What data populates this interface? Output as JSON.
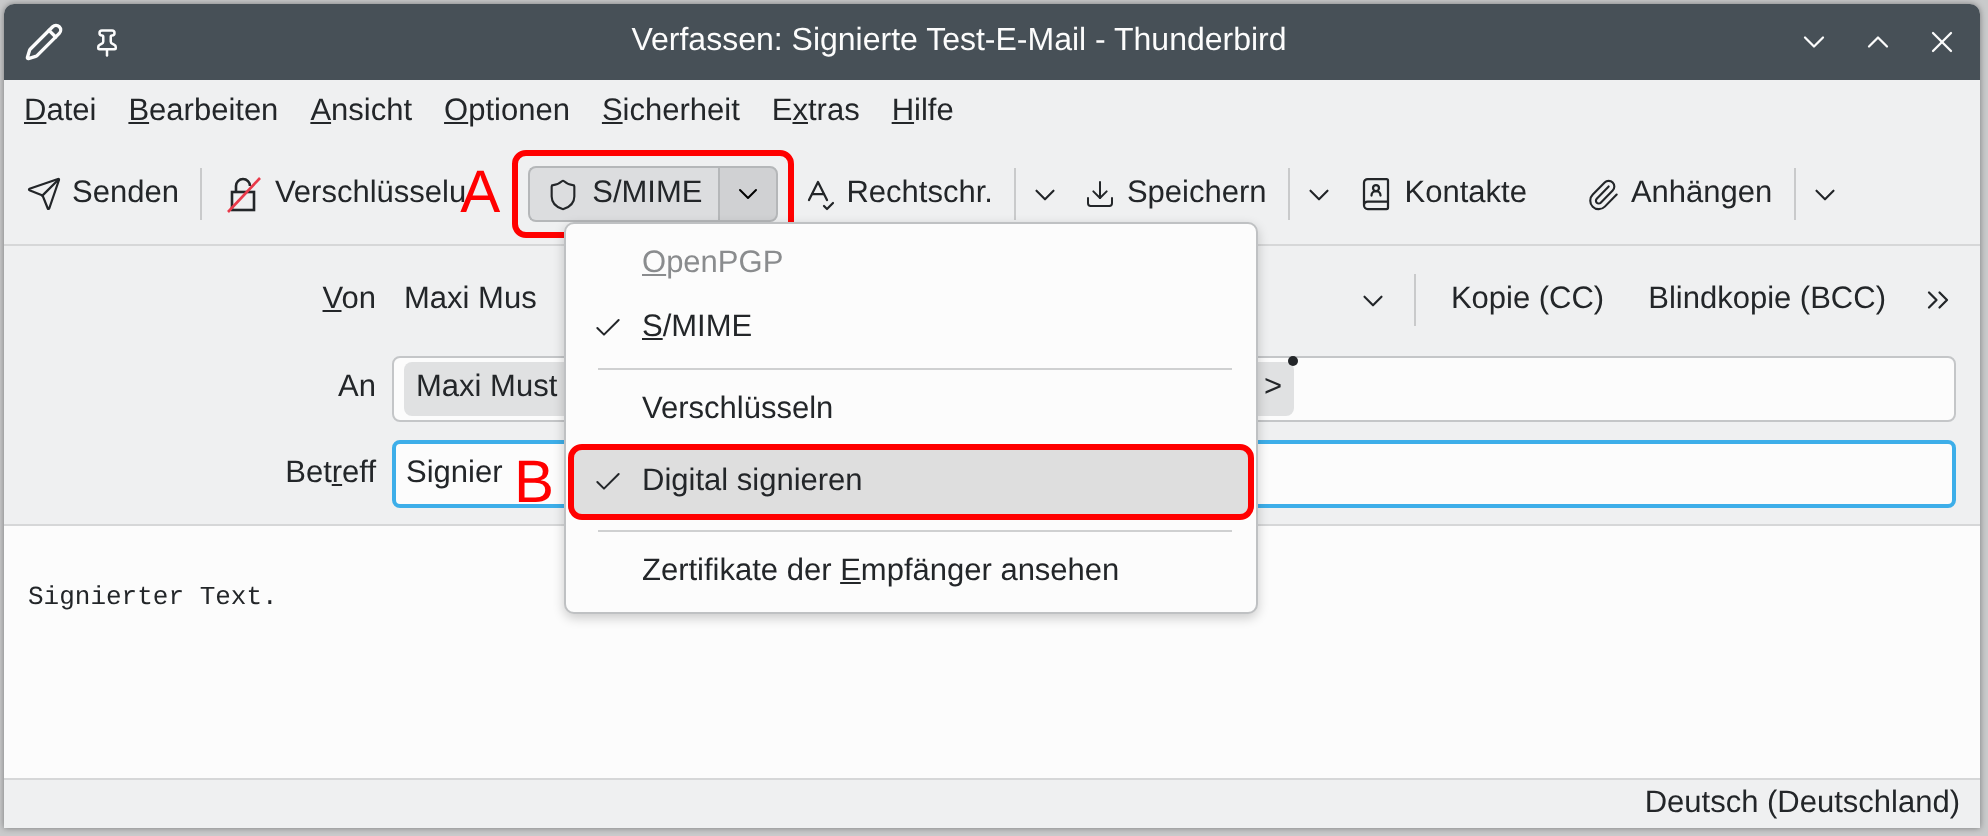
{
  "window": {
    "title": "Verfassen: Signierte Test-E-Mail - Thunderbird"
  },
  "menubar": [
    {
      "key": "D",
      "post": "atei"
    },
    {
      "key": "B",
      "post": "earbeiten"
    },
    {
      "key": "A",
      "post": "nsicht"
    },
    {
      "key": "O",
      "post": "ptionen"
    },
    {
      "key": "S",
      "post": "icherheit"
    },
    {
      "pre": "E",
      "key": "x",
      "post": "tras"
    },
    {
      "key": "H",
      "post": "ilfe"
    }
  ],
  "toolbar": [
    {
      "kind": "send",
      "label": "Senden"
    },
    {
      "kind": "encrypt",
      "label": "Verschlüsselu"
    },
    {
      "kind": "smime",
      "label": "S/MIME",
      "annotation": "A"
    },
    {
      "kind": "spell",
      "label": "Rechtschr.",
      "dropdown": true
    },
    {
      "kind": "save",
      "label": "Speichern",
      "dropdown": true
    },
    {
      "kind": "contacts",
      "label": "Kontakte"
    },
    {
      "kind": "attach",
      "label": "Anhängen",
      "dropdown": true
    }
  ],
  "header": {
    "from_label": {
      "key": "V",
      "post": "on"
    },
    "from_value": "Maxi Mus",
    "cc": "Kopie (CC)",
    "bcc": "Blindkopie (BCC)",
    "to_label": "An",
    "to_pill": "Maxi Must",
    "to_pill_tail": ">",
    "subject_label": {
      "pre": "Bet",
      "key": "r",
      "post": "eff"
    },
    "subject_value": "Signier"
  },
  "popup": [
    {
      "kind": "item",
      "key": "O",
      "post": "penPGP",
      "checked": false,
      "disabled": true,
      "selected": false
    },
    {
      "kind": "item",
      "key": "S",
      "post": "/MIME",
      "checked": true,
      "disabled": false,
      "selected": false
    },
    {
      "kind": "separator"
    },
    {
      "kind": "item",
      "pre": "Verschlüsseln",
      "checked": false,
      "disabled": false,
      "selected": false
    },
    {
      "kind": "item",
      "pre": "Di",
      "key": "g",
      "post": "ital signieren",
      "checked": true,
      "disabled": false,
      "selected": true,
      "annotation": "B"
    },
    {
      "kind": "separator"
    },
    {
      "kind": "item",
      "pre": "Zertifikate der ",
      "key": "E",
      "post": "mpfänger ansehen",
      "checked": false,
      "disabled": false,
      "selected": false
    }
  ],
  "body": {
    "text": "Signierter Text."
  },
  "status_bar": {
    "language": "Deutsch (Deutschland)"
  }
}
